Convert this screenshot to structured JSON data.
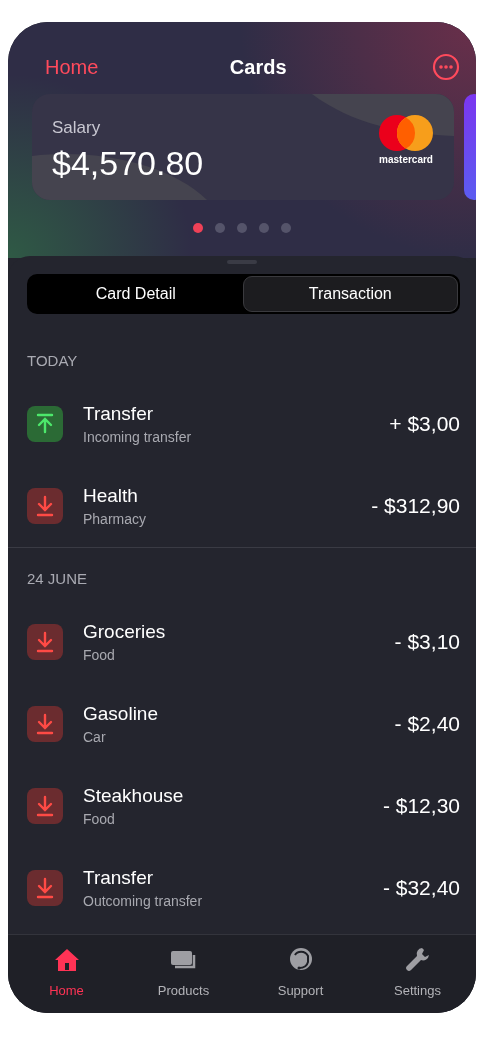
{
  "header": {
    "back": "Home",
    "title": "Cards"
  },
  "card": {
    "label": "Salary",
    "amount": "$4,570.80",
    "brand": "mastercard"
  },
  "pager": [
    {
      "selected": true
    },
    {
      "selected": false
    },
    {
      "selected": false
    },
    {
      "selected": false
    },
    {
      "selected": false
    }
  ],
  "tabs": [
    {
      "label": "Card Detail",
      "selected": false
    },
    {
      "label": "Transaction",
      "selected": true
    }
  ],
  "sections": [
    {
      "title": "TODAY",
      "transactions": [
        {
          "kind": "incoming",
          "name": "Transfer",
          "category": "Incoming transfer",
          "amount": "+ $3,00"
        },
        {
          "kind": "outgoing",
          "name": "Health",
          "category": "Pharmacy",
          "amount": "- $312,90"
        }
      ]
    },
    {
      "title": "24 JUNE",
      "transactions": [
        {
          "kind": "outgoing",
          "name": "Groceries",
          "category": "Food",
          "amount": "- $3,10"
        },
        {
          "kind": "outgoing",
          "name": "Gasoline",
          "category": "Car",
          "amount": "- $2,40"
        },
        {
          "kind": "outgoing",
          "name": "Steakhouse",
          "category": "Food",
          "amount": "- $12,30"
        },
        {
          "kind": "outgoing",
          "name": "Transfer",
          "category": "Outcoming transfer",
          "amount": "- $32,40"
        }
      ]
    }
  ],
  "nav": [
    {
      "kind": "home",
      "label": "Home",
      "selected": true
    },
    {
      "kind": "products",
      "label": "Products",
      "selected": false
    },
    {
      "kind": "support",
      "label": "Support",
      "selected": false
    },
    {
      "kind": "settings",
      "label": "Settings",
      "selected": false
    }
  ]
}
